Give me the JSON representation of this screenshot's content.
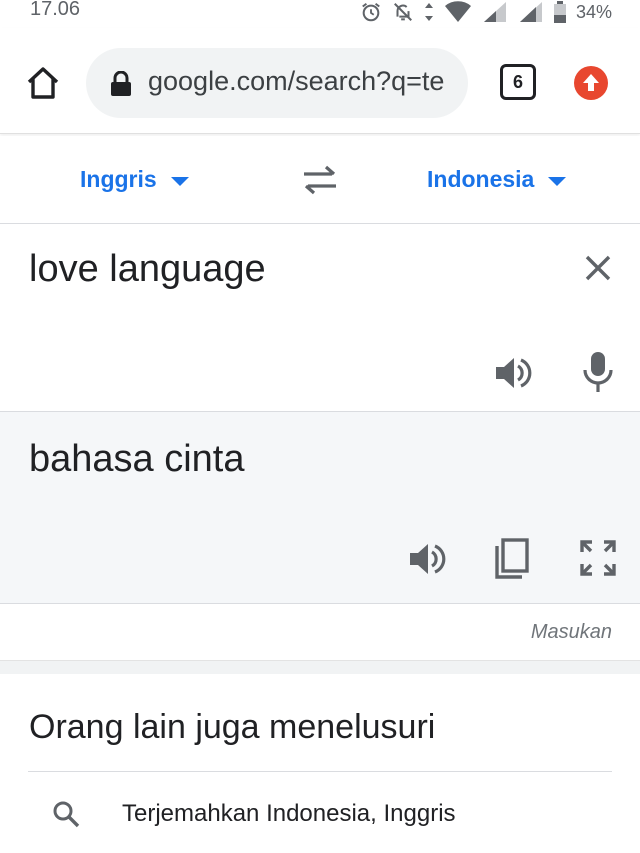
{
  "status_bar": {
    "time": "17.06",
    "battery": "34%",
    "icons": [
      "alarm-icon",
      "notifications-off-icon",
      "data-arrows-icon",
      "wifi-icon",
      "signal-icon",
      "signal-icon",
      "battery-icon"
    ]
  },
  "browser": {
    "url": "google.com/search?q=te",
    "tab_count": "6",
    "accent_color": "#e8472f"
  },
  "translator": {
    "source_language": "Inggris",
    "target_language": "Indonesia",
    "source_text": "love language",
    "translated_text": "bahasa cinta",
    "feedback_label": "Masukan",
    "link_color": "#1a73e8"
  },
  "related": {
    "title": "Orang lain juga menelusuri",
    "items": [
      {
        "label": "Terjemahkan Indonesia, Inggris"
      }
    ]
  }
}
